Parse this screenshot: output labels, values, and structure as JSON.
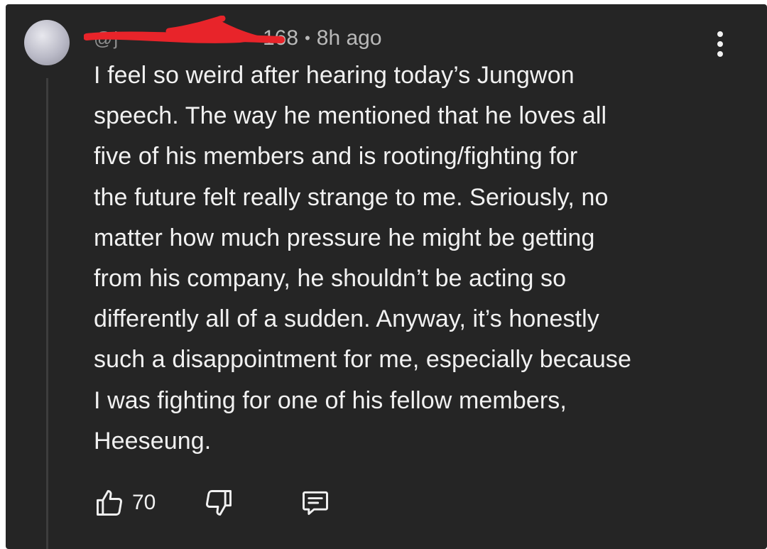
{
  "comment": {
    "author_suffix": "168",
    "separator": "•",
    "time": "8h ago",
    "lines": [
      "I feel so weird after hearing today’s Jungwon",
      "speech. The way he mentioned that he loves all",
      "five of his members and is rooting/fighting for",
      "the future felt really strange to me. Seriously, no",
      "matter how much pressure he might be getting",
      "from his company, he shouldn’t be acting so",
      "differently all of a sudden. Anyway, it’s honestly",
      "such a disappointment for me, especially because",
      "I was fighting for one of his fellow members,",
      "Heeseung."
    ]
  },
  "actions": {
    "like_count": "70"
  },
  "icons": {
    "menu": "more-vert-icon",
    "like": "thumb-up-icon",
    "dislike": "thumb-down-icon",
    "reply": "reply-comment-icon"
  },
  "colors": {
    "background": "#252525",
    "text": "#f1f1f1",
    "meta_text": "#b9b9b9",
    "redaction": "#e8242a"
  }
}
